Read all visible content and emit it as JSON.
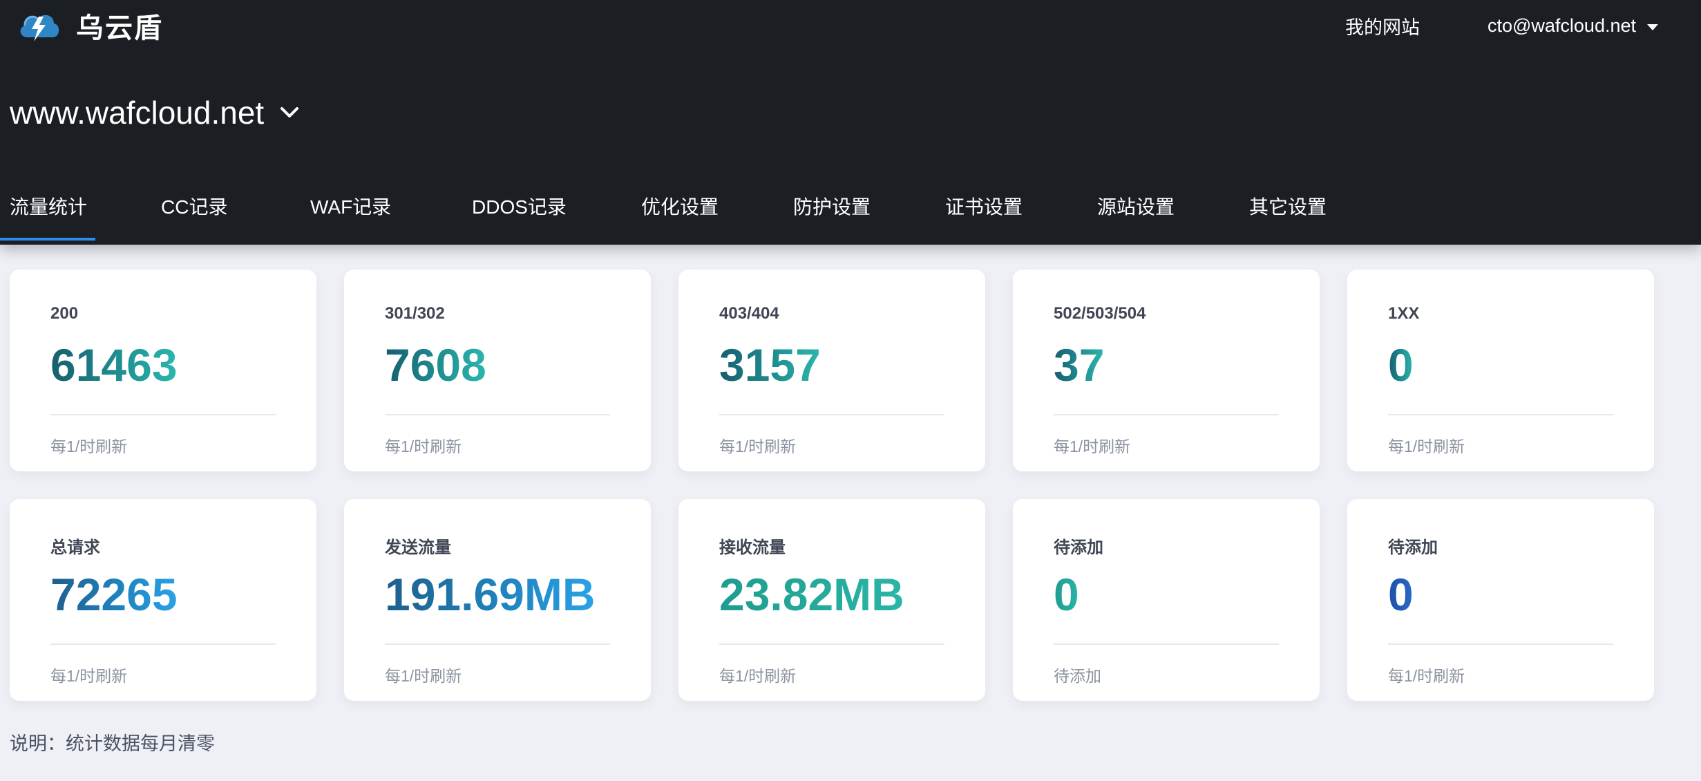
{
  "app": {
    "name": "乌云盾"
  },
  "nav": {
    "my_sites": "我的网站",
    "user_email": "cto@wafcloud.net"
  },
  "site": {
    "domain": "www.wafcloud.net"
  },
  "tabs": [
    {
      "label": "流量统计"
    },
    {
      "label": "CC记录"
    },
    {
      "label": "WAF记录"
    },
    {
      "label": "DDOS记录"
    },
    {
      "label": "优化设置"
    },
    {
      "label": "防护设置"
    },
    {
      "label": "证书设置"
    },
    {
      "label": "源站设置"
    },
    {
      "label": "其它设置"
    }
  ],
  "cards": [
    {
      "label": "200",
      "value": "61463",
      "footer": "每1/时刷新"
    },
    {
      "label": "301/302",
      "value": "7608",
      "footer": "每1/时刷新"
    },
    {
      "label": "403/404",
      "value": "3157",
      "footer": "每1/时刷新"
    },
    {
      "label": "502/503/504",
      "value": "37",
      "footer": "每1/时刷新"
    },
    {
      "label": "1XX",
      "value": "0",
      "footer": "每1/时刷新"
    },
    {
      "label": "总请求",
      "value": "72265",
      "footer": "每1/时刷新"
    },
    {
      "label": "发送流量",
      "value": "191.69MB",
      "footer": "每1/时刷新"
    },
    {
      "label": "接收流量",
      "value": "23.82MB",
      "footer": "每1/时刷新"
    },
    {
      "label": "待添加",
      "value": "0",
      "footer": "待添加"
    },
    {
      "label": "待添加",
      "value": "0",
      "footer": "每1/时刷新"
    }
  ],
  "note": "说明：统计数据每月清零",
  "colors": {
    "header_bg": "#1b1e23",
    "page_bg": "#eef0f5",
    "tab_active": "#2d8cf0"
  }
}
